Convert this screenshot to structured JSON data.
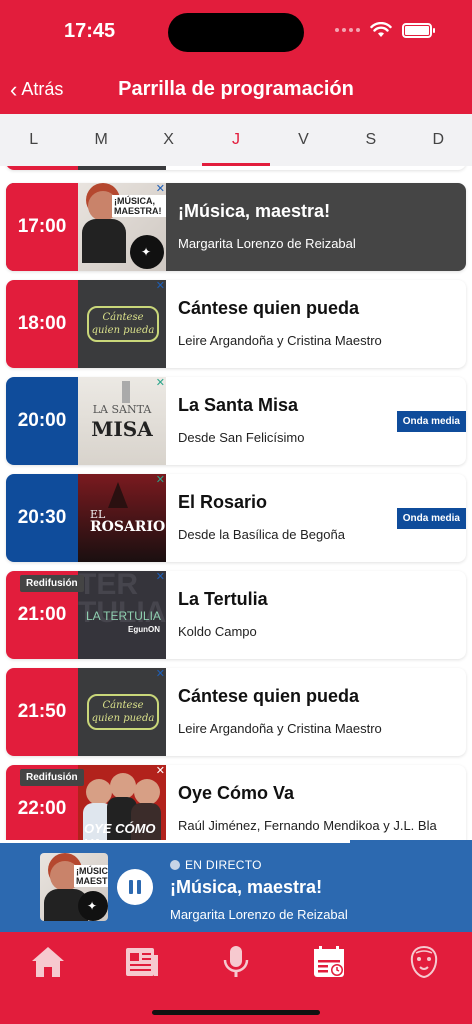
{
  "status": {
    "time": "17:45"
  },
  "header": {
    "back": "Atrás",
    "title": "Parrilla de programación"
  },
  "days": [
    "L",
    "M",
    "X",
    "J",
    "V",
    "S",
    "D"
  ],
  "active_day": "J",
  "programs": [
    {
      "time": "17:00",
      "title": "¡Música, maestra!",
      "subtitle": "Margarita Lorenzo de Reizabal",
      "thumb_text": "¡MÚSICA, MAESTRA!"
    },
    {
      "time": "18:00",
      "title": "Cántese quien pueda",
      "subtitle": "Leire Argandoña y Cristina Maestro",
      "thumb_text": "Cántese quien pueda"
    },
    {
      "time": "20:00",
      "title": "La Santa Misa",
      "subtitle": "Desde San Felicísimo",
      "badge": "Onda media",
      "thumb_text_1": "LA SANTA",
      "thumb_text_2": "MISA"
    },
    {
      "time": "20:30",
      "title": "El Rosario",
      "subtitle": "Desde la Basílica de Begoña",
      "badge": "Onda media",
      "thumb_text_1": "EL",
      "thumb_text_2": "ROSARIO"
    },
    {
      "time": "21:00",
      "title": "La Tertulia",
      "subtitle": "Koldo Campo",
      "tag": "Redifusión",
      "thumb_text_1": "LA TERTULIA",
      "thumb_text_2": "EgunON"
    },
    {
      "time": "21:50",
      "title": "Cántese quien pueda",
      "subtitle": "Leire Argandoña y Cristina Maestro",
      "thumb_text": "Cántese quien pueda"
    },
    {
      "time": "22:00",
      "title": "Oye Cómo Va",
      "subtitle": "Raúl Jiménez, Fernando Mendikoa y J.L. Bla",
      "tag": "Redifusión",
      "thumb_text": "OYE CÓMO VA"
    }
  ],
  "player": {
    "live": "EN DIRECTO",
    "title": "¡Música, maestra!",
    "subtitle": "Margarita Lorenzo de Reizabal",
    "thumb_text": "¡MÚSICA, MAESTRA!"
  },
  "tabs": [
    "home-icon",
    "newspaper-icon",
    "microphone-icon",
    "calendar-icon",
    "lion-logo-icon"
  ],
  "colors": {
    "brand_red": "#e21d3c",
    "live_blue": "#2c69b0",
    "onda_blue": "#0f4c9b",
    "now_playing_dark": "#454545"
  }
}
